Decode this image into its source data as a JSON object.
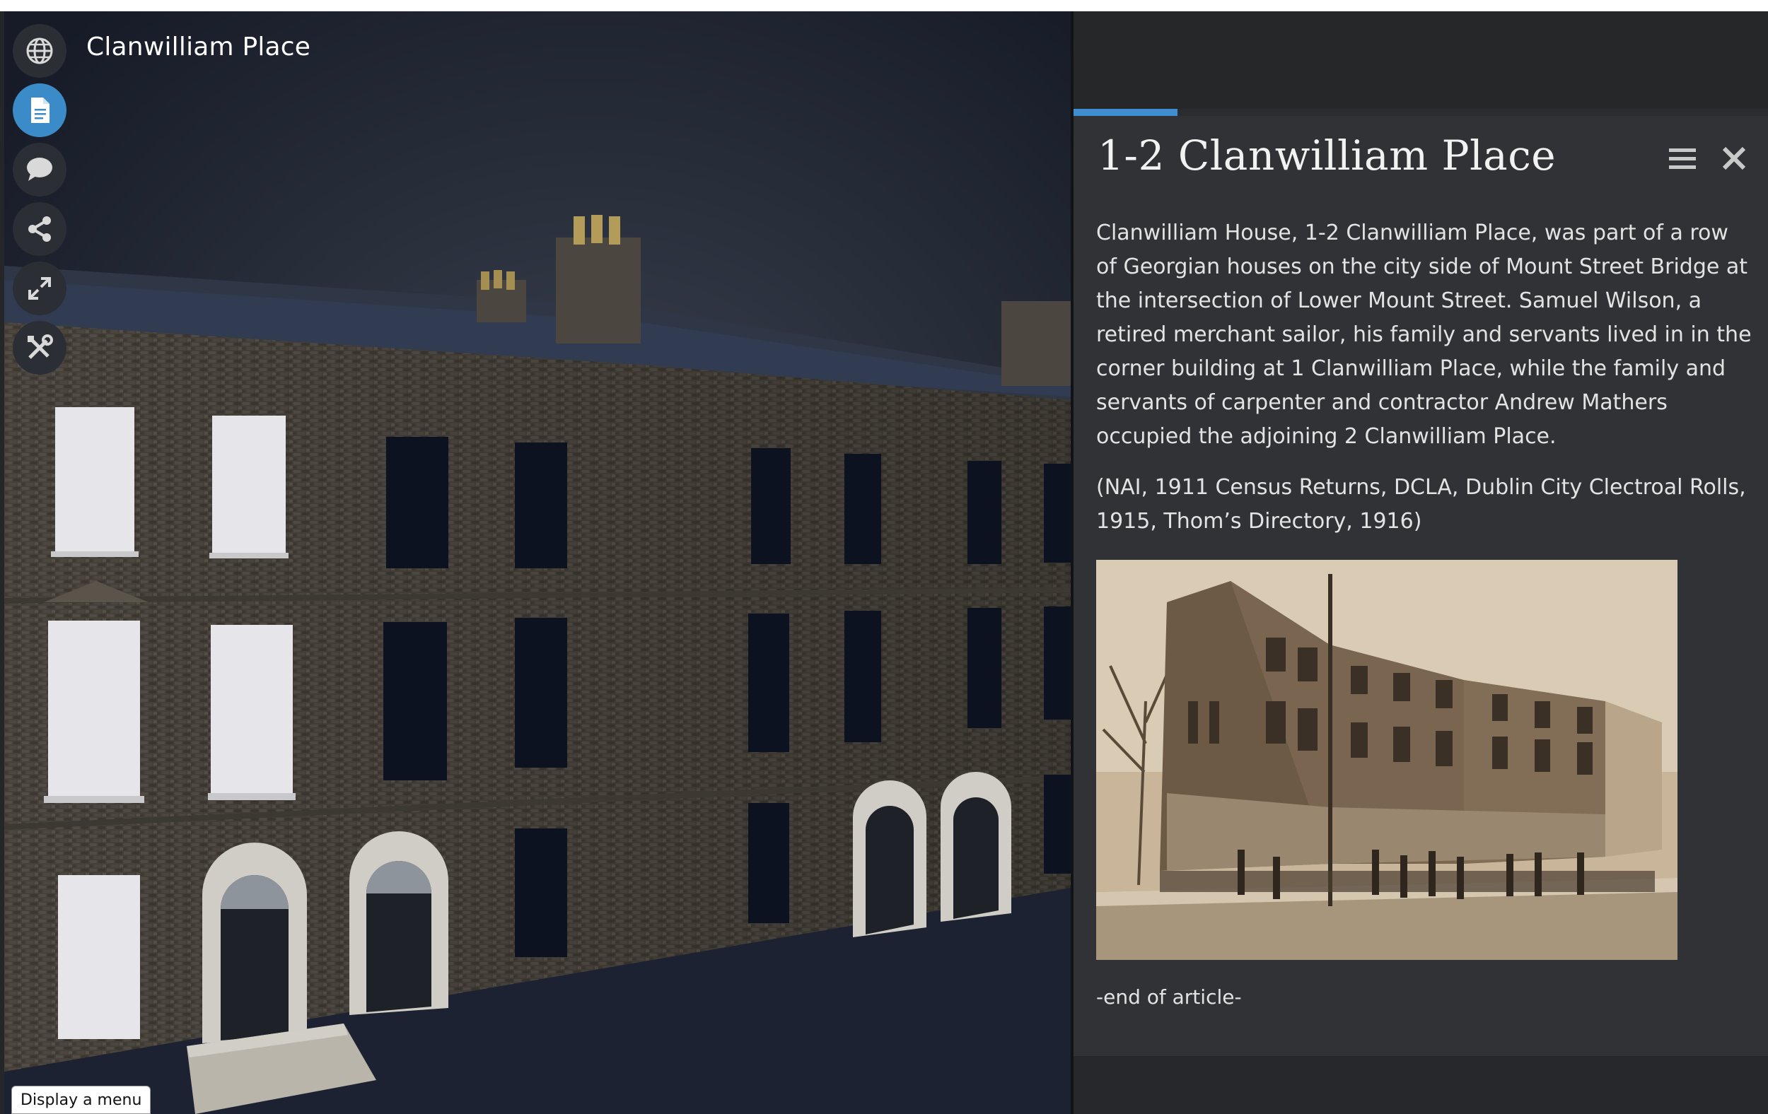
{
  "viewer": {
    "title": "Clanwilliam Place",
    "tooltip": "Display a menu",
    "tools": [
      {
        "icon": "globe-icon",
        "active": false
      },
      {
        "icon": "document-icon",
        "active": true
      },
      {
        "icon": "chat-bubble-icon",
        "active": false
      },
      {
        "icon": "share-icon",
        "active": false
      },
      {
        "icon": "expand-icon",
        "active": false
      },
      {
        "icon": "tools-icon",
        "active": false
      }
    ]
  },
  "panel": {
    "progress_fraction": 0.15,
    "accent_color": "#3f8ed0",
    "article_title": "1-2 Clanwilliam Place",
    "paragraphs": [
      "Clanwilliam House, 1-2 Clanwilliam Place, was part of a row of Georgian houses on the city side of Mount Street Bridge at the intersection of Lower Mount Street. Samuel Wilson, a retired merchant sailor, his family and servants lived in in the corner building at 1 Clanwilliam Place, while the family and servants of carpenter and contractor Andrew Mathers occupied the adjoining 2 Clanwilliam Place.",
      "(NAI, 1911 Census Returns, DCLA, Dublin City Clectroal Rolls, 1915, Thom’s Directory, 1916)"
    ],
    "end_note": "-end of article-",
    "menu_icon": "hamburger-menu-icon",
    "close_icon": "close-icon"
  }
}
